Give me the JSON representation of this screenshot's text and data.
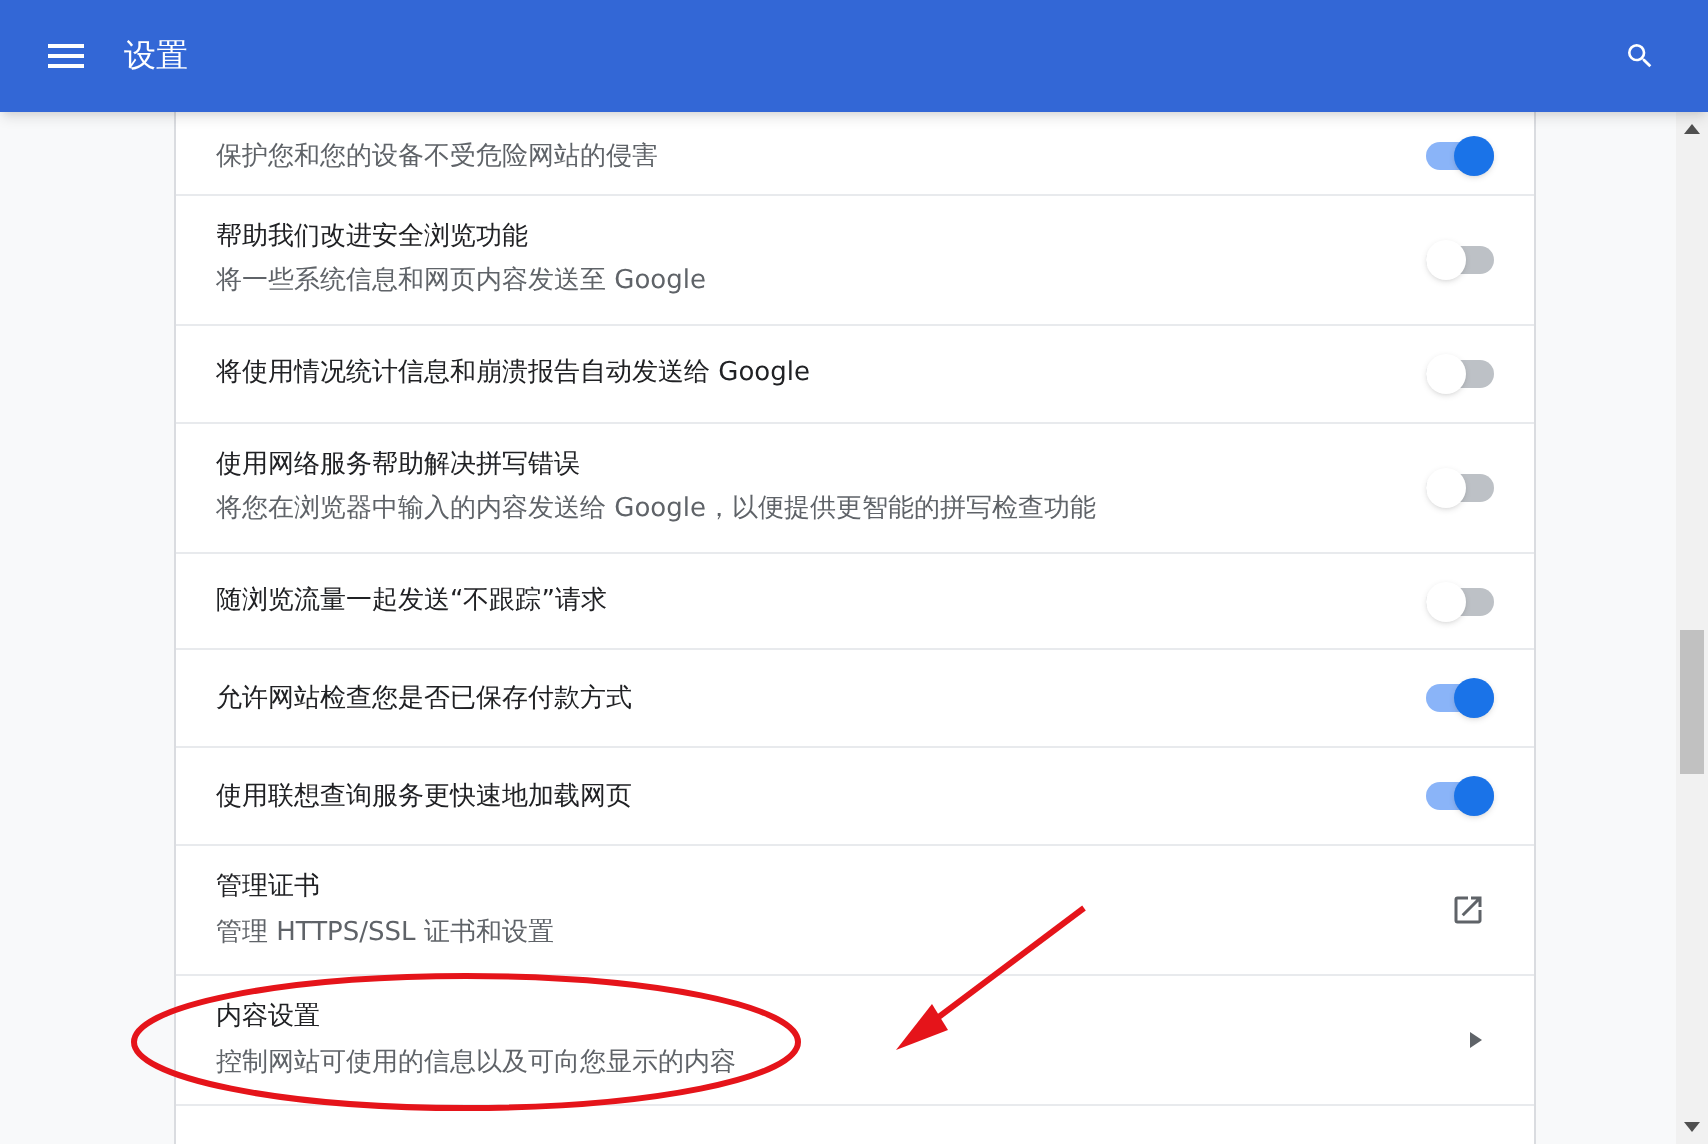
{
  "header": {
    "title": "设置"
  },
  "rows": [
    {
      "kind": "toggle",
      "description": "保护您和您的设备不受危险网站的侵害",
      "on": true
    },
    {
      "kind": "toggle",
      "title": "帮助我们改进安全浏览功能",
      "description": "将一些系统信息和网页内容发送至 Google",
      "on": false
    },
    {
      "kind": "toggle",
      "title": "将使用情况统计信息和崩溃报告自动发送给 Google",
      "on": false
    },
    {
      "kind": "toggle",
      "title": "使用网络服务帮助解决拼写错误",
      "description": "将您在浏览器中输入的内容发送给 Google，以便提供更智能的拼写检查功能",
      "on": false
    },
    {
      "kind": "toggle",
      "title": "随浏览流量一起发送“不跟踪”请求",
      "on": false
    },
    {
      "kind": "toggle",
      "title": "允许网站检查您是否已保存付款方式",
      "on": true
    },
    {
      "kind": "toggle",
      "title": "使用联想查询服务更快速地加载网页",
      "on": true
    },
    {
      "kind": "external",
      "title": "管理证书",
      "description": "管理 HTTPS/SSL 证书和设置"
    },
    {
      "kind": "submenu",
      "title": "内容设置",
      "description": "控制网站可使用的信息以及可向您显示的内容"
    },
    {
      "kind": "cut"
    }
  ]
}
